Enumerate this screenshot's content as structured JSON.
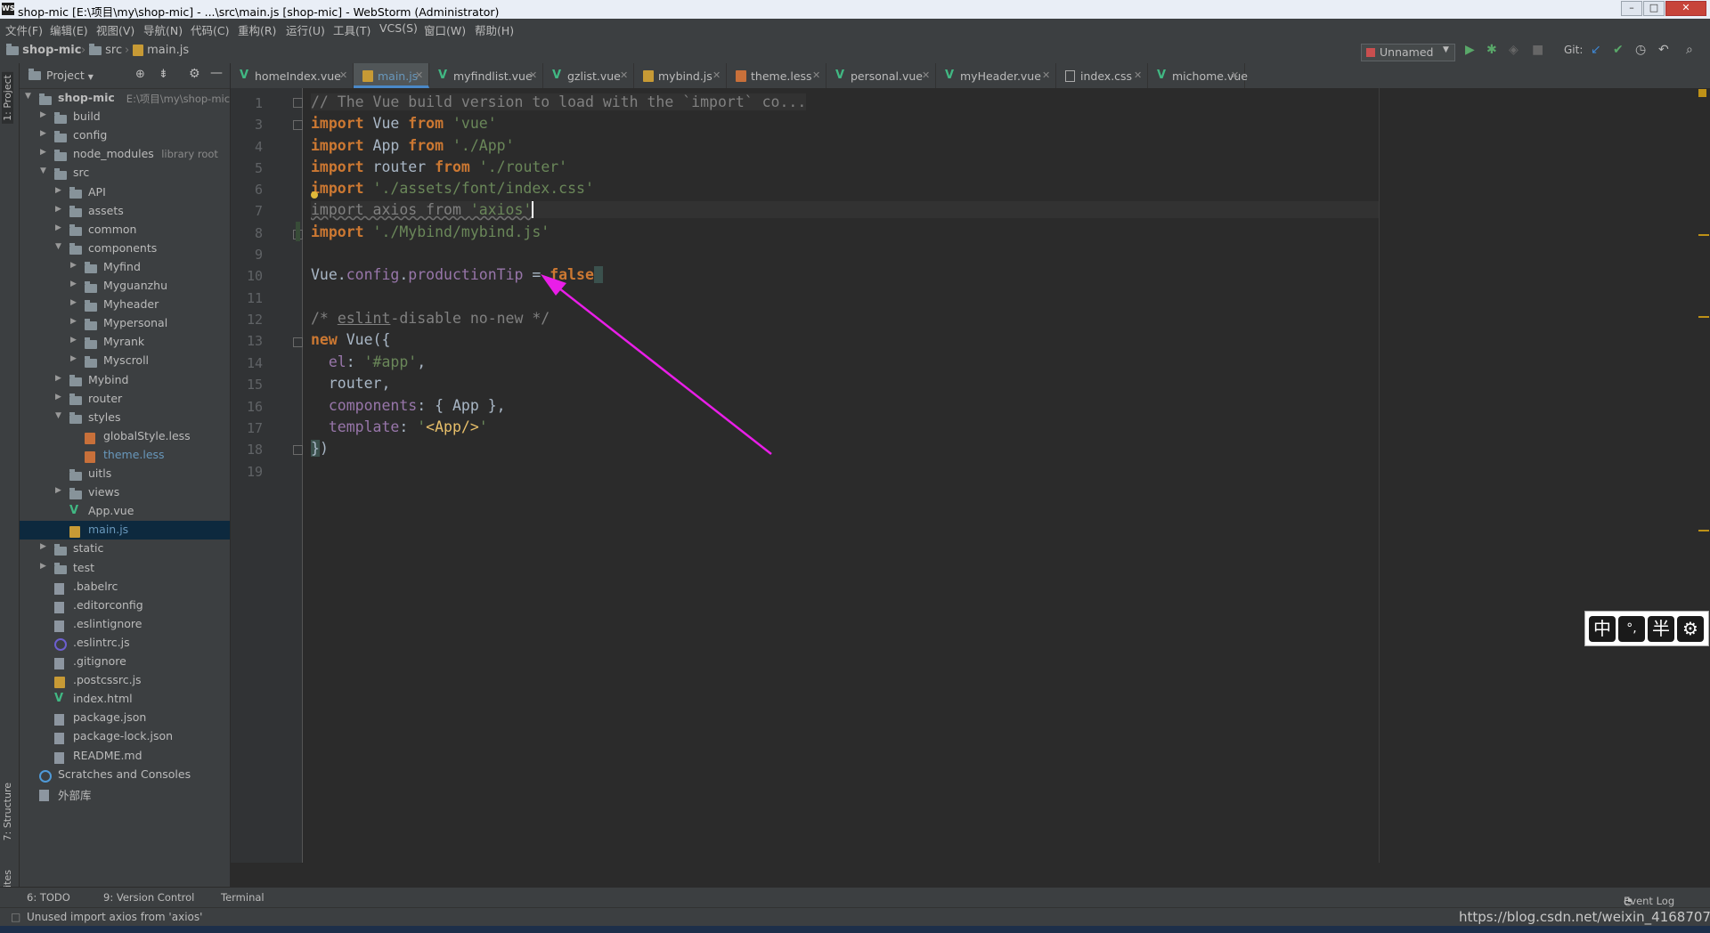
{
  "window": {
    "title": "shop-mic [E:\\项目\\my\\shop-mic] - ...\\src\\main.js [shop-mic] - WebStorm (Administrator)",
    "app_logo": "WS"
  },
  "menu": [
    "文件(F)",
    "编辑(E)",
    "视图(V)",
    "导航(N)",
    "代码(C)",
    "重构(R)",
    "运行(U)",
    "工具(T)",
    "VCS(S)",
    "窗口(W)",
    "帮助(H)"
  ],
  "breadcrumb": {
    "project": "shop-mic",
    "folder": "src",
    "file": "main.js"
  },
  "toolbar": {
    "run_config": "Unnamed",
    "git_label": "Git:"
  },
  "tool_windows": {
    "left": [
      "1: Project",
      "7: Structure",
      "2: Favorites"
    ],
    "bottom": [
      "6: TODO",
      "9: Version Control",
      "Terminal"
    ],
    "event_log": "Event Log"
  },
  "project_panel": {
    "title": "Project",
    "tree": [
      {
        "label": "shop-mic",
        "hint": "E:\\项目\\my\\shop-mic",
        "bold": true,
        "expanded": true,
        "icon": "folder-icon"
      },
      {
        "label": "build",
        "icon": "folder-icon"
      },
      {
        "label": "config",
        "icon": "folder-icon"
      },
      {
        "label": "node_modules",
        "hint": "library root",
        "icon": "folder-icon"
      },
      {
        "label": "src",
        "expanded": true,
        "icon": "folder-icon"
      },
      {
        "label": "API",
        "icon": "folder-icon"
      },
      {
        "label": "assets",
        "icon": "folder-icon"
      },
      {
        "label": "common",
        "icon": "folder-icon"
      },
      {
        "label": "components",
        "expanded": true,
        "icon": "folder-icon"
      },
      {
        "label": "Myfind",
        "icon": "folder-icon"
      },
      {
        "label": "Myguanzhu",
        "icon": "folder-icon"
      },
      {
        "label": "Myheader",
        "icon": "folder-icon"
      },
      {
        "label": "Mypersonal",
        "icon": "folder-icon"
      },
      {
        "label": "Myrank",
        "icon": "folder-icon"
      },
      {
        "label": "Myscroll",
        "icon": "folder-icon"
      },
      {
        "label": "Mybind",
        "icon": "folder-icon"
      },
      {
        "label": "router",
        "icon": "folder-icon"
      },
      {
        "label": "styles",
        "expanded": true,
        "icon": "folder-icon"
      },
      {
        "label": "globalStyle.less",
        "icon": "less-icon"
      },
      {
        "label": "theme.less",
        "icon": "less-icon",
        "color": "#6897bb"
      },
      {
        "label": "uitls",
        "icon": "folder-icon"
      },
      {
        "label": "views",
        "icon": "folder-icon"
      },
      {
        "label": "App.vue",
        "icon": "vue-icon"
      },
      {
        "label": "main.js",
        "icon": "js-icon",
        "selected": true,
        "color": "#6897bb"
      },
      {
        "label": "static",
        "icon": "folder-icon"
      },
      {
        "label": "test",
        "icon": "folder-icon"
      },
      {
        "label": ".babelrc",
        "icon": "file-icon"
      },
      {
        "label": ".editorconfig",
        "icon": "file-icon"
      },
      {
        "label": ".eslintignore",
        "icon": "file-icon"
      },
      {
        "label": ".eslintrc.js",
        "icon": "eslint-icon"
      },
      {
        "label": ".gitignore",
        "icon": "file-icon"
      },
      {
        "label": ".postcssrc.js",
        "icon": "js-icon"
      },
      {
        "label": "index.html",
        "icon": "vue-icon"
      },
      {
        "label": "package.json",
        "icon": "file-icon"
      },
      {
        "label": "package-lock.json",
        "icon": "file-icon"
      },
      {
        "label": "README.md",
        "icon": "file-icon"
      },
      {
        "label": "Scratches and Consoles",
        "icon": "scratches-icon"
      },
      {
        "label": "外部库",
        "icon": "library-icon"
      }
    ]
  },
  "tabs": [
    {
      "label": "homeIndex.vue",
      "icon": "vue-icon"
    },
    {
      "label": "main.js",
      "icon": "js-icon",
      "active": true
    },
    {
      "label": "myfindlist.vue",
      "icon": "vue-icon"
    },
    {
      "label": "gzlist.vue",
      "icon": "vue-icon"
    },
    {
      "label": "mybind.js",
      "icon": "js-icon"
    },
    {
      "label": "theme.less",
      "icon": "less-icon"
    },
    {
      "label": "personal.vue",
      "icon": "vue-icon"
    },
    {
      "label": "myHeader.vue",
      "icon": "vue-icon"
    },
    {
      "label": "index.css",
      "icon": "css-icon"
    },
    {
      "label": "michome.vue",
      "icon": "vue-icon"
    }
  ],
  "editor": {
    "line_numbers": [
      "1",
      "3",
      "4",
      "5",
      "6",
      "7",
      "8",
      "9",
      "10",
      "11",
      "12",
      "13",
      "14",
      "15",
      "16",
      "17",
      "18",
      "19"
    ]
  },
  "ime_toolbar": [
    "中",
    "°,",
    "半",
    "⚙"
  ],
  "status": {
    "message": "Unused import axios from 'axios'",
    "watermark": "https://blog.csdn.net/weixin_41687078"
  },
  "colors": {
    "keyword": "#cc7832",
    "string": "#6a8759",
    "property": "#9876aa",
    "comment": "#808080",
    "annotation_arrow": "#e91ee8"
  }
}
